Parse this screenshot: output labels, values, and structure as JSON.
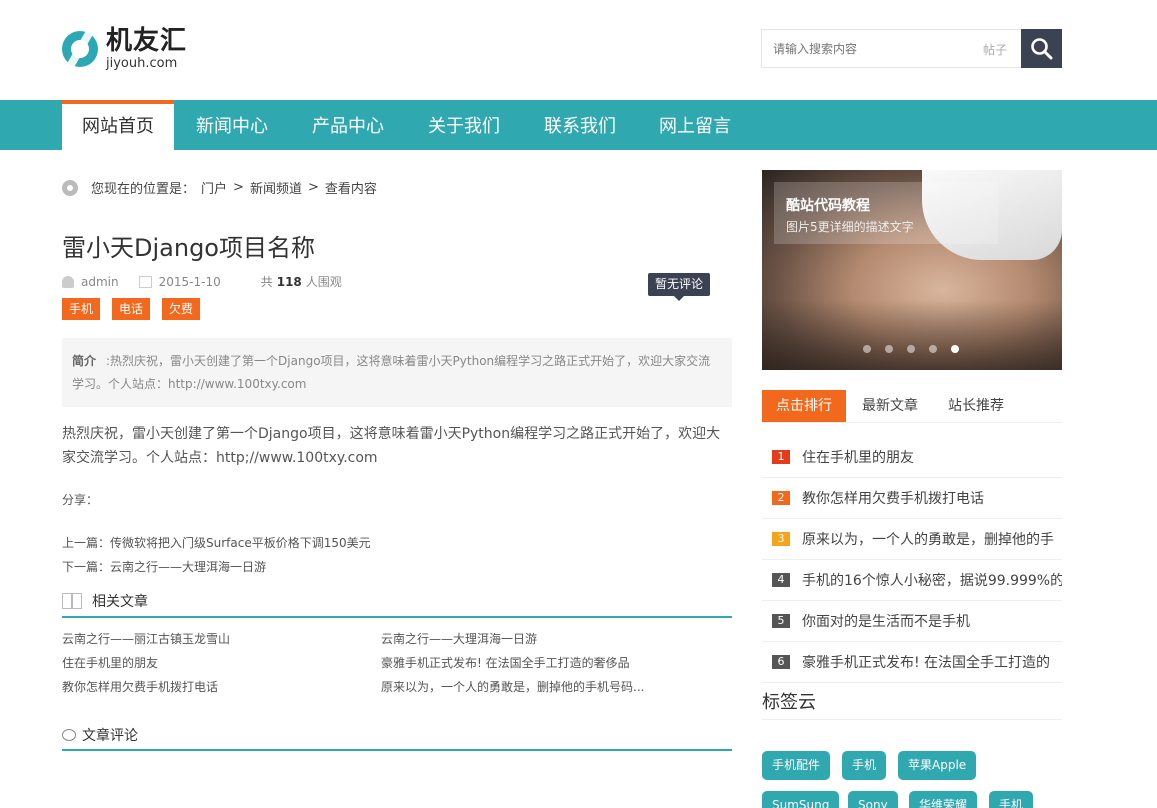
{
  "header": {
    "logo_cn": "机友汇",
    "logo_en": "jiyouh.com",
    "search_placeholder": "请输入搜索内容",
    "search_type": "帖子",
    "search_icon": "search-icon"
  },
  "nav": {
    "items": [
      {
        "label": "网站首页",
        "active": true
      },
      {
        "label": "新闻中心"
      },
      {
        "label": "产品中心"
      },
      {
        "label": "关于我们"
      },
      {
        "label": "联系我们"
      },
      {
        "label": "网上留言"
      }
    ],
    "accent": "#30a8b0",
    "active_border": "#f2691d"
  },
  "breadcrumb": {
    "prefix": "您现在的位置是：",
    "items": [
      "门户",
      ">",
      "新闻频道",
      ">",
      "查看内容"
    ]
  },
  "article": {
    "title": "雷小天Django项目名称",
    "author": "admin",
    "date": "2015-1-10",
    "views_prefix": "共",
    "views": "118",
    "views_suffix": "人围观",
    "comment_tooltip": "暂无评论",
    "tags": [
      "手机",
      "电话",
      "欠费"
    ],
    "summary_label": "简介",
    "summary": ":热烈庆祝，雷小天创建了第一个Django项目，这将意味着雷小天Python编程学习之路正式开始了，欢迎大家交流学习。个人站点：http://www.100txy.com",
    "body": "热烈庆祝，雷小天创建了第一个Django项目，这将意味着雷小天Python编程学习之路正式开始了，欢迎大家交流学习。个人站点：http;//www.100txy.com",
    "share": "分享：",
    "prev": "上一篇：传微软将把入门级Surface平板价格下调150美元",
    "next": "下一篇：云南之行——大理洱海一日游"
  },
  "related": {
    "title": "相关文章",
    "items": [
      "云南之行——丽江古镇玉龙雪山",
      "云南之行——大理洱海一日游",
      "住在手机里的朋友",
      "豪雅手机正式发布! 在法国全手工打造的奢侈品",
      "教你怎样用欠费手机拨打电话",
      "原来以为，一个人的勇敢是，删掉他的手机号码..."
    ]
  },
  "comments": {
    "title": "文章评论"
  },
  "sidebar": {
    "banner_title": "酷站代码教程",
    "banner_sub": "图片5更详细的描述文字",
    "slides": 5,
    "active_slide": 5,
    "tabs": [
      "点击排行",
      "最新文章",
      "站长推荐"
    ],
    "rank": [
      {
        "num": "1",
        "title": "住在手机里的朋友",
        "color": "#e33b1c"
      },
      {
        "num": "2",
        "title": "教你怎样用欠费手机拨打电话",
        "color": "#f2691d"
      },
      {
        "num": "3",
        "title": "原来以为，一个人的勇敢是，删掉他的手",
        "color": "#f5a51c"
      },
      {
        "num": "4",
        "title": "手机的16个惊人小秘密，据说99.999%的",
        "color": "#555555"
      },
      {
        "num": "5",
        "title": "你面对的是生活而不是手机",
        "color": "#555555"
      },
      {
        "num": "6",
        "title": "豪雅手机正式发布! 在法国全手工打造的",
        "color": "#555555"
      }
    ],
    "cloud_title": "标签云",
    "cloud": [
      "手机配件",
      "手机",
      "苹果Apple",
      "SumSung",
      "Sony",
      "华维荣耀",
      "手机"
    ]
  }
}
